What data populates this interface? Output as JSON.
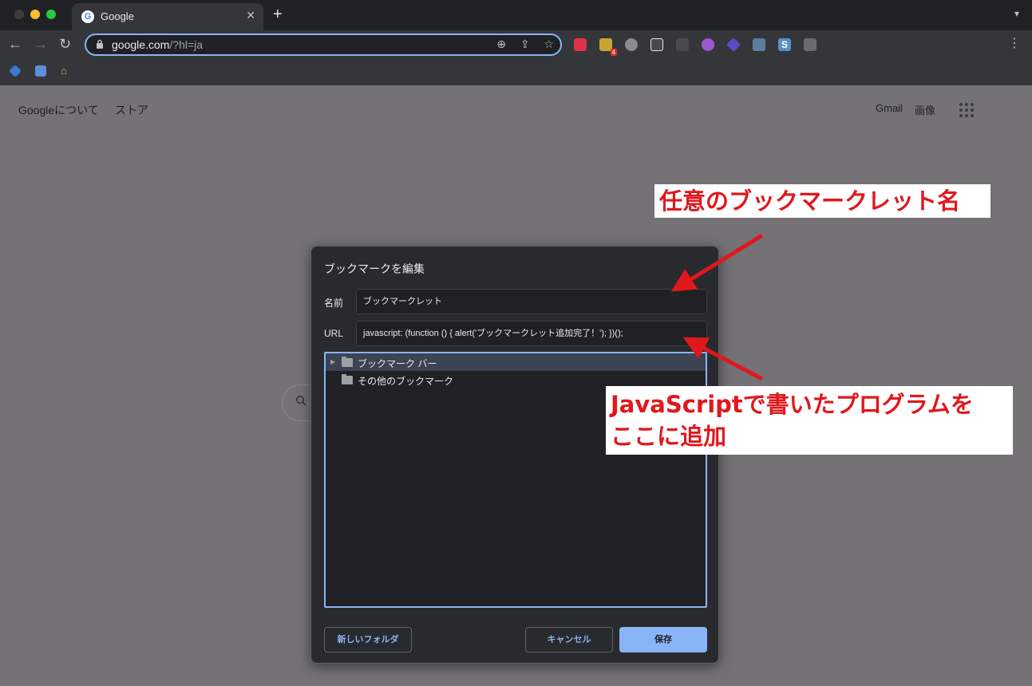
{
  "browser": {
    "tab": {
      "title": "Google",
      "favicon": "G"
    },
    "toolbar": {
      "url_host": "google.com",
      "url_path": "/?hl=ja",
      "back_icon": "←",
      "forward_icon": "→",
      "reload_icon": "↻",
      "lock_icon": "🔒",
      "menu_icon": "⋮"
    },
    "extension_badge": "4"
  },
  "page": {
    "about_link": "Googleについて",
    "store_link": "ストア",
    "gmail_link": "Gmail",
    "images_link": "画像"
  },
  "dialog": {
    "title": "ブックマークを編集",
    "name_label": "名前",
    "name_value": "ブックマークレット",
    "url_label": "URL",
    "url_value": "javascript: (function () {   alert('ブックマークレット追加完了！'); })();",
    "folders": [
      {
        "label": "ブックマーク バー",
        "selected": true,
        "expandable": true
      },
      {
        "label": "その他のブックマーク",
        "selected": false,
        "expandable": false
      }
    ],
    "new_folder_button": "新しいフォルダ",
    "cancel_button": "キャンセル",
    "save_button": "保存"
  },
  "annotations": {
    "name_callout": "任意のブックマークレット名",
    "url_callout_line1": "JavaScriptで書いたプログラムを",
    "url_callout_line2": "ここに追加",
    "color": "#e0181d"
  },
  "colors": {
    "accent": "#8ab4f8",
    "page_overlay": "#747275",
    "dialog_bg": "#292a2d"
  }
}
